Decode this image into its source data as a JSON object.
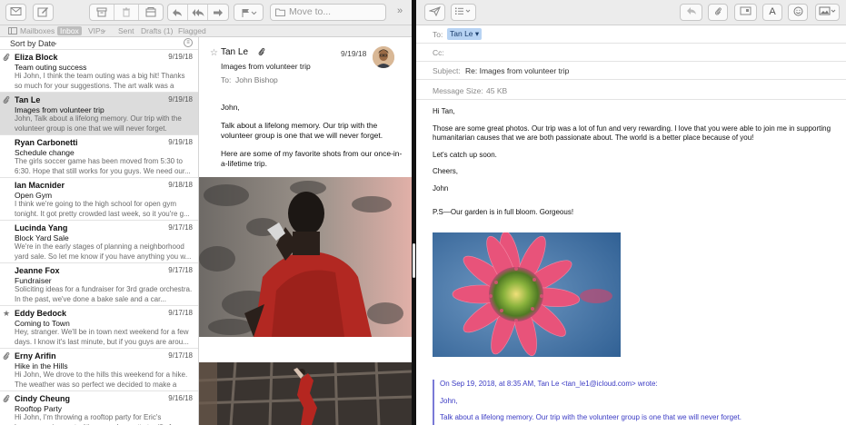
{
  "left_toolbar": {
    "moveto_placeholder": "Move to..."
  },
  "favorites": [
    {
      "label": "Mailboxes",
      "active": false
    },
    {
      "label": "Inbox",
      "active": true
    },
    {
      "label": "VIPs",
      "active": false
    },
    {
      "label": "Sent",
      "active": false
    },
    {
      "label": "Drafts (1)",
      "active": false
    },
    {
      "label": "Flagged",
      "active": false
    }
  ],
  "message_list": {
    "sort_label": "Sort by Date",
    "messages": [
      {
        "from": "Eliza Block",
        "date": "9/19/18",
        "subject": "Team outing success",
        "preview": "Hi John, I think the team outing was a big hit! Thanks so much for your suggestions. The art walk was a great...",
        "icon": "paperclip-icon",
        "selected": false
      },
      {
        "from": "Tan Le",
        "date": "9/19/18",
        "subject": "Images from volunteer trip",
        "preview": "John, Talk about a lifelong memory. Our trip with the volunteer group is one that we will never forget. Here're...",
        "icon": "paperclip-icon",
        "selected": true
      },
      {
        "from": "Ryan Carbonetti",
        "date": "9/19/18",
        "subject": "Schedule change",
        "preview": "The girls soccer game has been moved from 5:30 to 6:30. Hope that still works for you guys. We need our...",
        "icon": "",
        "selected": false
      },
      {
        "from": "Ian Macnider",
        "date": "9/18/18",
        "subject": "Open Gym",
        "preview": "I think we're going to the high school for open gym tonight. It got pretty crowded last week, so it you're g...",
        "icon": "",
        "selected": false
      },
      {
        "from": "Lucinda Yang",
        "date": "9/17/18",
        "subject": "Block Yard Sale",
        "preview": "We're in the early stages of planning a neighborhood yard sale. So let me know if you have anything you w...",
        "icon": "",
        "selected": false
      },
      {
        "from": "Jeanne Fox",
        "date": "9/17/18",
        "subject": "Fundraiser",
        "preview": "Soliciting ideas for a fundraiser for 3rd grade orchestra. In the past, we've done a bake sale and a car...",
        "icon": "",
        "selected": false
      },
      {
        "from": "Eddy Bedock",
        "date": "9/17/18",
        "subject": "Coming to Town",
        "preview": "Hey, stranger. We'll be in town next weekend for a few days. I know it's last minute, but if you guys are arou...",
        "icon": "star-icon",
        "selected": false
      },
      {
        "from": "Erny Arifin",
        "date": "9/17/18",
        "subject": "Hike in the Hills",
        "preview": "Hi John, We drove to the hills this weekend for a hike. The weather was so perfect we decided to make a day...",
        "icon": "paperclip-icon",
        "selected": false
      },
      {
        "from": "Cindy Cheung",
        "date": "9/16/18",
        "subject": "Rooftop Party",
        "preview": "Hi John, I'm throwing a rooftop party for Eric's housewarming party. It's gonna be pretty terrific for everyone!",
        "icon": "paperclip-icon",
        "selected": false
      }
    ]
  },
  "reading_pane": {
    "from": "Tan Le",
    "date": "9/19/18",
    "subject": "Images from volunteer trip",
    "to_label": "To:",
    "to_name": "John Bishop",
    "body": [
      "John,",
      "Talk about a lifelong memory. Our trip with the volunteer group is one that we will never forget.",
      "Here are some of my favorite shots from our once-in-a-lifetime trip."
    ]
  },
  "compose": {
    "to_label": "To:",
    "to_value": "Tan Le",
    "cc_label": "Cc:",
    "subject_label": "Subject:",
    "subject_value": "Re: Images from volunteer trip",
    "size_label": "Message Size:",
    "size_value": "45 KB",
    "body": [
      "Hi Tan,",
      "Those are some great photos. Our trip was a lot of fun and very rewarding. I love that you were able to join me in supporting humanitarian causes that we are both passionate about. The world is a better place because of you!",
      "Let's catch up soon.",
      "Cheers,",
      "John",
      "P.S—Our garden is in full bloom. Gorgeous!"
    ],
    "quote": [
      "On Sep 19, 2018, at 8:35 AM, Tan Le <tan_le1@icloud.com> wrote:",
      "John,",
      "Talk about a lifelong memory. Our trip with the volunteer group is one that we will never forget."
    ],
    "font_button_label": "A"
  },
  "colors": {
    "selection_token": "#b7d3f3",
    "quote_blue": "#3b3bc4",
    "toolbar_bg": "#ececec",
    "selected_row": "#dcdcdc"
  }
}
